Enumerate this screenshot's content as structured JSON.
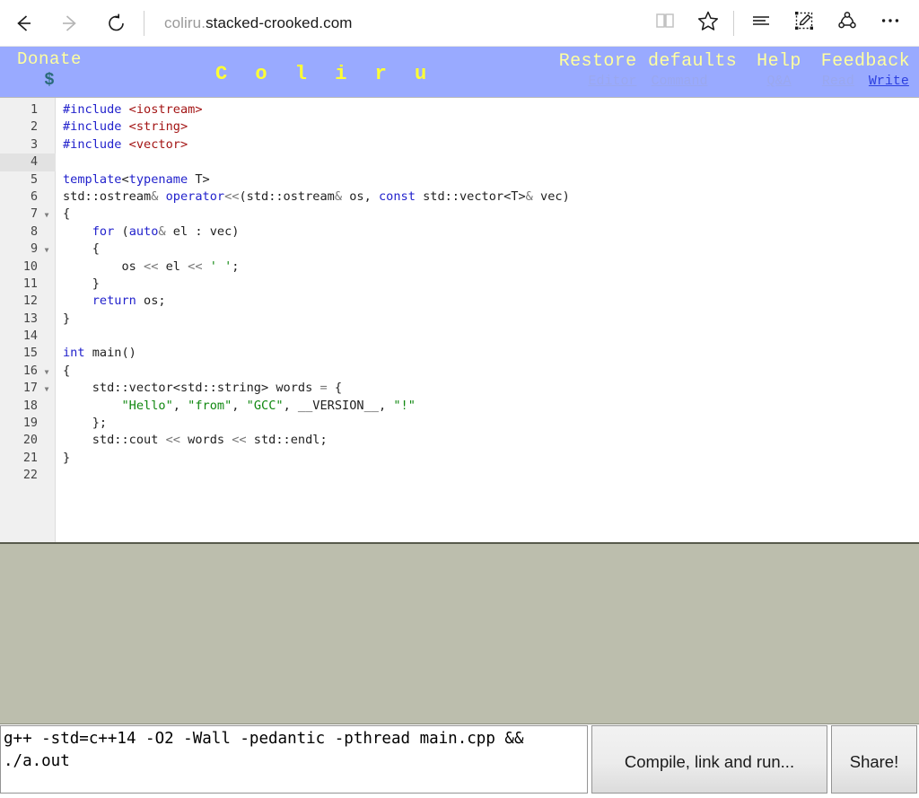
{
  "browser": {
    "back_icon": "back-arrow-icon",
    "forward_icon": "forward-arrow-icon",
    "refresh_icon": "refresh-icon",
    "url_prefix": "coliru.",
    "url_main": "stacked-crooked.com",
    "reading_view_icon": "book-icon",
    "favorites_icon": "star-icon",
    "hub_icon": "hub-lines-icon",
    "web_note_icon": "pencil-note-icon",
    "share_icon": "share-nodes-icon",
    "more_icon": "ellipsis-icon"
  },
  "site_header": {
    "background": "#99aaff",
    "donate_label": "Donate",
    "donate_symbol": "$",
    "brand": "C o l i r u",
    "nav": [
      {
        "title": "Restore defaults",
        "links": [
          {
            "label": "Editor",
            "accent": false
          },
          {
            "label": "Command",
            "accent": false
          }
        ]
      },
      {
        "title": "Help",
        "links": [
          {
            "label": "Q&A",
            "accent": false
          }
        ]
      },
      {
        "title": "Feedback",
        "links": [
          {
            "label": "Read",
            "accent": false
          },
          {
            "label": "Write",
            "accent": true
          }
        ]
      }
    ]
  },
  "editor": {
    "active_line": 4,
    "fold_lines": [
      7,
      9,
      16,
      17
    ],
    "lines": [
      {
        "n": 1,
        "tokens": [
          {
            "t": "#include",
            "c": "inc"
          },
          {
            "t": " ",
            "c": "pl"
          },
          {
            "t": "<iostream>",
            "c": "hdr"
          }
        ]
      },
      {
        "n": 2,
        "tokens": [
          {
            "t": "#include",
            "c": "inc"
          },
          {
            "t": " ",
            "c": "pl"
          },
          {
            "t": "<string>",
            "c": "hdr"
          }
        ]
      },
      {
        "n": 3,
        "tokens": [
          {
            "t": "#include",
            "c": "inc"
          },
          {
            "t": " ",
            "c": "pl"
          },
          {
            "t": "<vector>",
            "c": "hdr"
          }
        ]
      },
      {
        "n": 4,
        "tokens": []
      },
      {
        "n": 5,
        "tokens": [
          {
            "t": "template",
            "c": "kw"
          },
          {
            "t": "<",
            "c": "pl"
          },
          {
            "t": "typename",
            "c": "kw"
          },
          {
            "t": " T>",
            "c": "pl"
          }
        ]
      },
      {
        "n": 6,
        "tokens": [
          {
            "t": "std::ostream",
            "c": "pl"
          },
          {
            "t": "&",
            "c": "op"
          },
          {
            "t": " ",
            "c": "pl"
          },
          {
            "t": "operator",
            "c": "kw"
          },
          {
            "t": "<<",
            "c": "op"
          },
          {
            "t": "(std::ostream",
            "c": "pl"
          },
          {
            "t": "&",
            "c": "op"
          },
          {
            "t": " os, ",
            "c": "pl"
          },
          {
            "t": "const",
            "c": "kw"
          },
          {
            "t": " std::vector<T>",
            "c": "pl"
          },
          {
            "t": "&",
            "c": "op"
          },
          {
            "t": " vec)",
            "c": "pl"
          }
        ]
      },
      {
        "n": 7,
        "tokens": [
          {
            "t": "{",
            "c": "pl"
          }
        ]
      },
      {
        "n": 8,
        "tokens": [
          {
            "t": "    ",
            "c": "pl"
          },
          {
            "t": "for",
            "c": "kw"
          },
          {
            "t": " (",
            "c": "pl"
          },
          {
            "t": "auto",
            "c": "kw"
          },
          {
            "t": "&",
            "c": "op"
          },
          {
            "t": " el : vec)",
            "c": "pl"
          }
        ]
      },
      {
        "n": 9,
        "tokens": [
          {
            "t": "    {",
            "c": "pl"
          }
        ]
      },
      {
        "n": 10,
        "tokens": [
          {
            "t": "        os ",
            "c": "pl"
          },
          {
            "t": "<<",
            "c": "op"
          },
          {
            "t": " el ",
            "c": "pl"
          },
          {
            "t": "<<",
            "c": "op"
          },
          {
            "t": " ",
            "c": "pl"
          },
          {
            "t": "' '",
            "c": "str"
          },
          {
            "t": ";",
            "c": "pl"
          }
        ]
      },
      {
        "n": 11,
        "tokens": [
          {
            "t": "    }",
            "c": "pl"
          }
        ]
      },
      {
        "n": 12,
        "tokens": [
          {
            "t": "    ",
            "c": "pl"
          },
          {
            "t": "return",
            "c": "kw"
          },
          {
            "t": " os;",
            "c": "pl"
          }
        ]
      },
      {
        "n": 13,
        "tokens": [
          {
            "t": "}",
            "c": "pl"
          }
        ]
      },
      {
        "n": 14,
        "tokens": []
      },
      {
        "n": 15,
        "tokens": [
          {
            "t": "int",
            "c": "kw"
          },
          {
            "t": " main()",
            "c": "pl"
          }
        ]
      },
      {
        "n": 16,
        "tokens": [
          {
            "t": "{",
            "c": "pl"
          }
        ]
      },
      {
        "n": 17,
        "tokens": [
          {
            "t": "    std::vector<std::string> words ",
            "c": "pl"
          },
          {
            "t": "=",
            "c": "op"
          },
          {
            "t": " {",
            "c": "pl"
          }
        ]
      },
      {
        "n": 18,
        "tokens": [
          {
            "t": "        ",
            "c": "pl"
          },
          {
            "t": "\"Hello\"",
            "c": "str"
          },
          {
            "t": ", ",
            "c": "pl"
          },
          {
            "t": "\"from\"",
            "c": "str"
          },
          {
            "t": ", ",
            "c": "pl"
          },
          {
            "t": "\"GCC\"",
            "c": "str"
          },
          {
            "t": ", __VERSION__, ",
            "c": "pl"
          },
          {
            "t": "\"!\"",
            "c": "str"
          }
        ]
      },
      {
        "n": 19,
        "tokens": [
          {
            "t": "    };",
            "c": "pl"
          }
        ]
      },
      {
        "n": 20,
        "tokens": [
          {
            "t": "    std::cout ",
            "c": "pl"
          },
          {
            "t": "<<",
            "c": "op"
          },
          {
            "t": " words ",
            "c": "pl"
          },
          {
            "t": "<<",
            "c": "op"
          },
          {
            "t": " std::endl;",
            "c": "pl"
          }
        ]
      },
      {
        "n": 21,
        "tokens": [
          {
            "t": "}",
            "c": "pl"
          }
        ]
      },
      {
        "n": 22,
        "tokens": []
      }
    ]
  },
  "output": {
    "background": "#bcbead",
    "text": ""
  },
  "command_bar": {
    "command_value": "g++ -std=c++14 -O2 -Wall -pedantic -pthread main.cpp && ./a.out",
    "command_placeholder": "",
    "compile_run_label": "Compile, link and run...",
    "share_label": "Share!"
  }
}
